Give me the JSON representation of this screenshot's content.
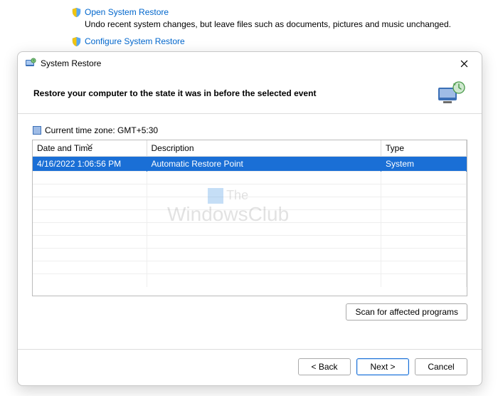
{
  "background": {
    "open_link": "Open System Restore",
    "open_desc": "Undo recent system changes, but leave files such as documents, pictures and music unchanged.",
    "configure_link": "Configure System Restore"
  },
  "dialog": {
    "title": "System Restore",
    "heading": "Restore your computer to the state it was in before the selected event",
    "timezone_label": "Current time zone: GMT+5:30",
    "table": {
      "col_date": "Date and Time",
      "col_desc": "Description",
      "col_type": "Type",
      "rows": [
        {
          "date": "4/16/2022 1:06:56 PM",
          "desc": "Automatic Restore Point",
          "type": "System"
        }
      ]
    },
    "scan_button": "Scan for affected programs",
    "buttons": {
      "back": "< Back",
      "next": "Next >",
      "cancel": "Cancel"
    }
  },
  "watermark_line1": "The",
  "watermark_line2": "WindowsClub"
}
